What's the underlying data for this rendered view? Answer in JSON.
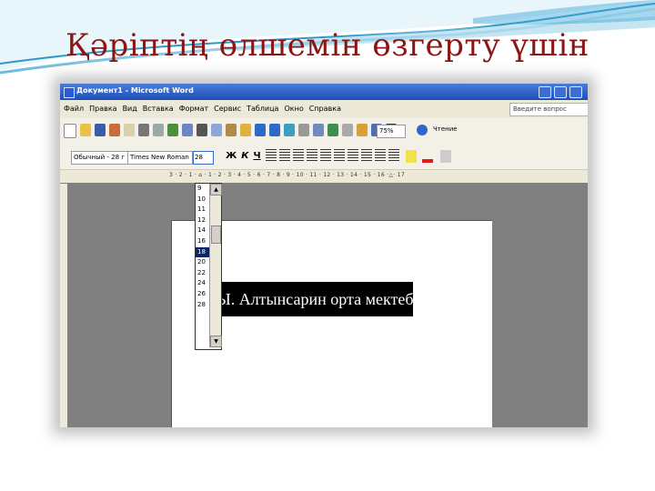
{
  "slide": {
    "title": "Қәріптің өлшемін өзгерту үшін"
  },
  "window": {
    "title": "Документ1 - Microsoft Word"
  },
  "menu": {
    "items": [
      "Файл",
      "Правка",
      "Вид",
      "Вставка",
      "Формат",
      "Сервис",
      "Таблица",
      "Окно",
      "Справка"
    ],
    "help_placeholder": "Введите вопрос"
  },
  "toolbar": {
    "zoom": "75%",
    "reading": "Чтение"
  },
  "format": {
    "style": "Обычный - 28 г",
    "font": "Times New Roman",
    "size": "28",
    "bold": "Ж",
    "italic": "К",
    "underline": "Ч"
  },
  "ruler": {
    "scale": "3 · 2 · 1 · ⌂ · 1 · 2 · 3 · 4 · 5 · 6 · 7 · 8 · 9 · 10 · 11 · 12 · 13 · 14 · 15 · 16 ·△· 17"
  },
  "font_size_dropdown": {
    "options": [
      "9",
      "10",
      "11",
      "12",
      "14",
      "16",
      "18",
      "20",
      "22",
      "24",
      "26",
      "28"
    ],
    "selected": "18"
  },
  "document": {
    "text": "Ы. Алтынсарин орта мектебі"
  }
}
